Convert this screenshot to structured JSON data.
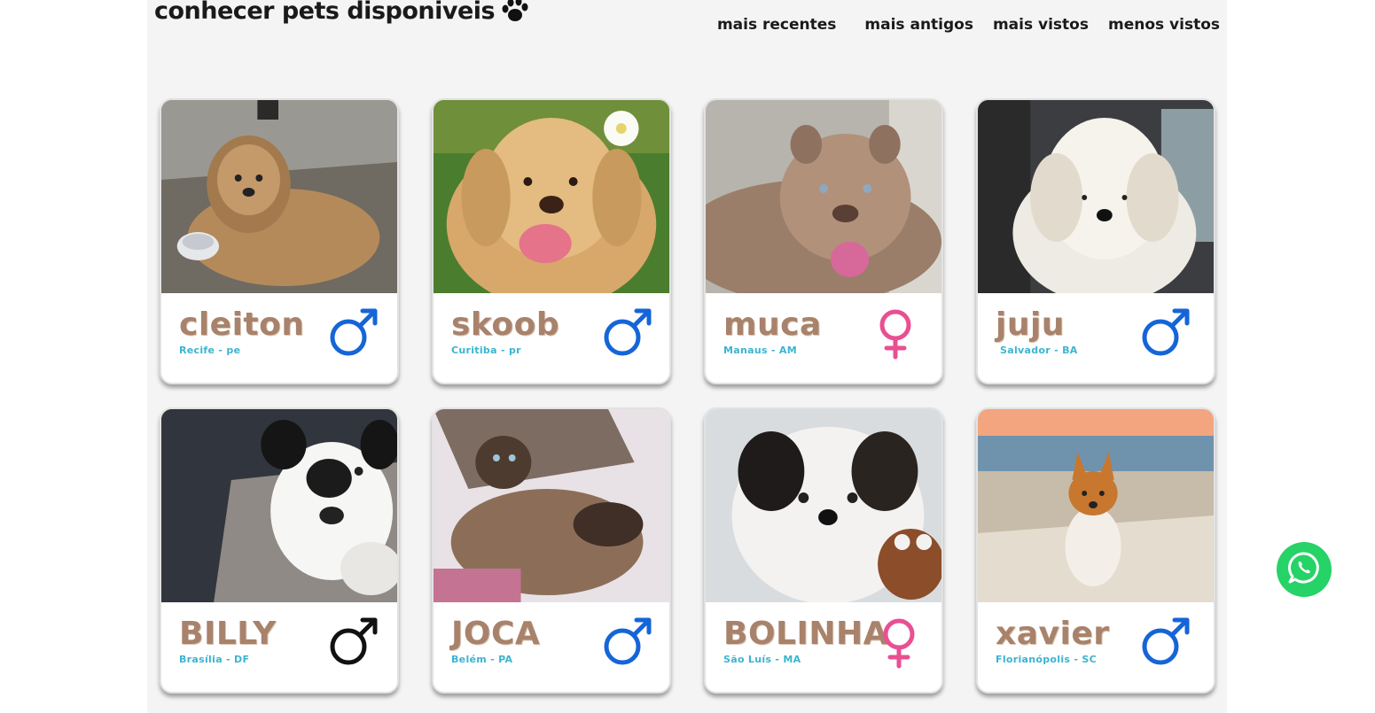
{
  "heading": "conhecer pets disponiveis",
  "sort_options": [
    "mais recentes",
    "mais antigos",
    "mais vistos",
    "menos vistos"
  ],
  "colors": {
    "male": "#1565d8",
    "female": "#e94f93",
    "male_alt": "#111111",
    "name": "#a8826a",
    "location": "#3bb4d1",
    "whatsapp": "#25d366"
  },
  "pets": [
    {
      "name": "cleiton",
      "location": "Recife - pe",
      "sex_icon": "male-icon"
    },
    {
      "name": "skoob",
      "location": "Curitiba - pr",
      "sex_icon": "male-icon"
    },
    {
      "name": "muca",
      "location": "Manaus - AM",
      "sex_icon": "female-icon"
    },
    {
      "name": "juju",
      "location": "Salvador - BA",
      "sex_icon": "male-icon"
    },
    {
      "name": "BILLY",
      "location": "Brasília - DF",
      "sex_icon": "male-icon"
    },
    {
      "name": "JOCA",
      "location": "Belém - PA",
      "sex_icon": "male-icon"
    },
    {
      "name": "BOLINHA",
      "location": "São Luís - MA",
      "sex_icon": "female-icon"
    },
    {
      "name": "xavier",
      "location": "Florianópolis - SC",
      "sex_icon": "male-icon"
    }
  ],
  "whatsapp_icon": "whatsapp-icon"
}
